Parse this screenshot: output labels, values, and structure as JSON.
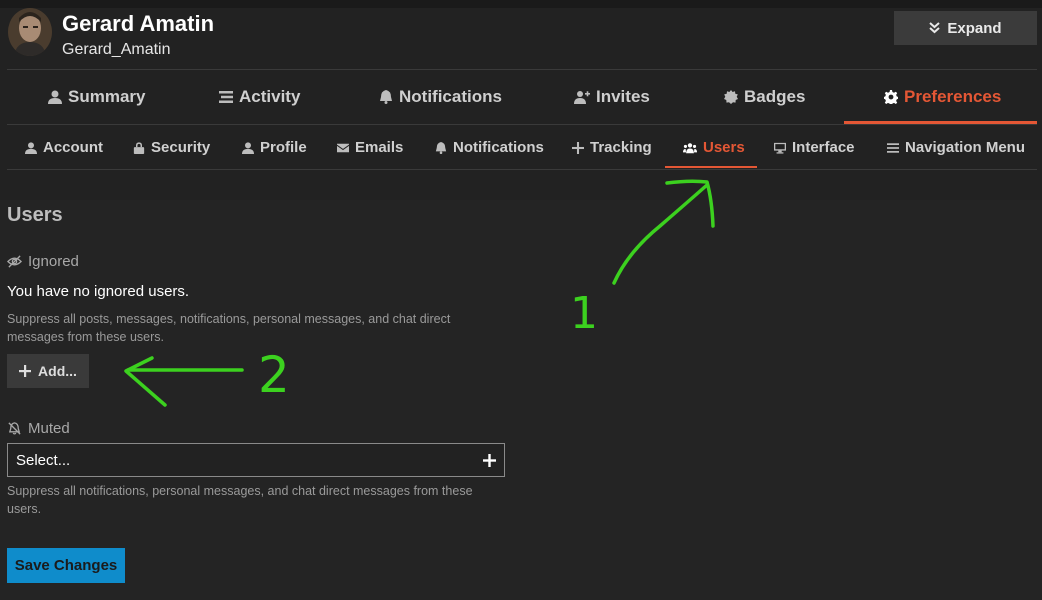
{
  "header": {
    "name": "Gerard Amatin",
    "username": "Gerard_Amatin",
    "expand_label": "Expand"
  },
  "primary_nav": {
    "items": [
      {
        "label": "Summary",
        "icon": "user-icon"
      },
      {
        "label": "Activity",
        "icon": "stream-icon"
      },
      {
        "label": "Notifications",
        "icon": "bell-icon"
      },
      {
        "label": "Invites",
        "icon": "user-plus-icon"
      },
      {
        "label": "Badges",
        "icon": "certificate-icon"
      },
      {
        "label": "Preferences",
        "icon": "gear-icon",
        "active": true
      }
    ]
  },
  "secondary_nav": {
    "items": [
      {
        "label": "Account",
        "icon": "user-icon"
      },
      {
        "label": "Security",
        "icon": "lock-icon"
      },
      {
        "label": "Profile",
        "icon": "user-icon"
      },
      {
        "label": "Emails",
        "icon": "envelope-icon"
      },
      {
        "label": "Notifications",
        "icon": "bell-icon"
      },
      {
        "label": "Tracking",
        "icon": "plus-icon"
      },
      {
        "label": "Users",
        "icon": "users-icon",
        "active": true
      },
      {
        "label": "Interface",
        "icon": "desktop-icon"
      },
      {
        "label": "Navigation Menu",
        "icon": "bars-icon"
      }
    ]
  },
  "content": {
    "title": "Users",
    "ignored": {
      "label": "Ignored",
      "empty_text": "You have no ignored users.",
      "help_text": "Suppress all posts, messages, notifications, personal messages, and chat direct messages from these users.",
      "add_label": "Add..."
    },
    "muted": {
      "label": "Muted",
      "select_value": "Select...",
      "help_text": "Suppress all notifications, personal messages, and chat direct messages from these users."
    },
    "save_label": "Save Changes"
  },
  "annotations": {
    "marker_1": "1",
    "marker_2": "2",
    "color": "#3cd11f"
  },
  "colors": {
    "accent": "#e45735",
    "primary_button": "#0f8ccb",
    "background": "#222222"
  }
}
